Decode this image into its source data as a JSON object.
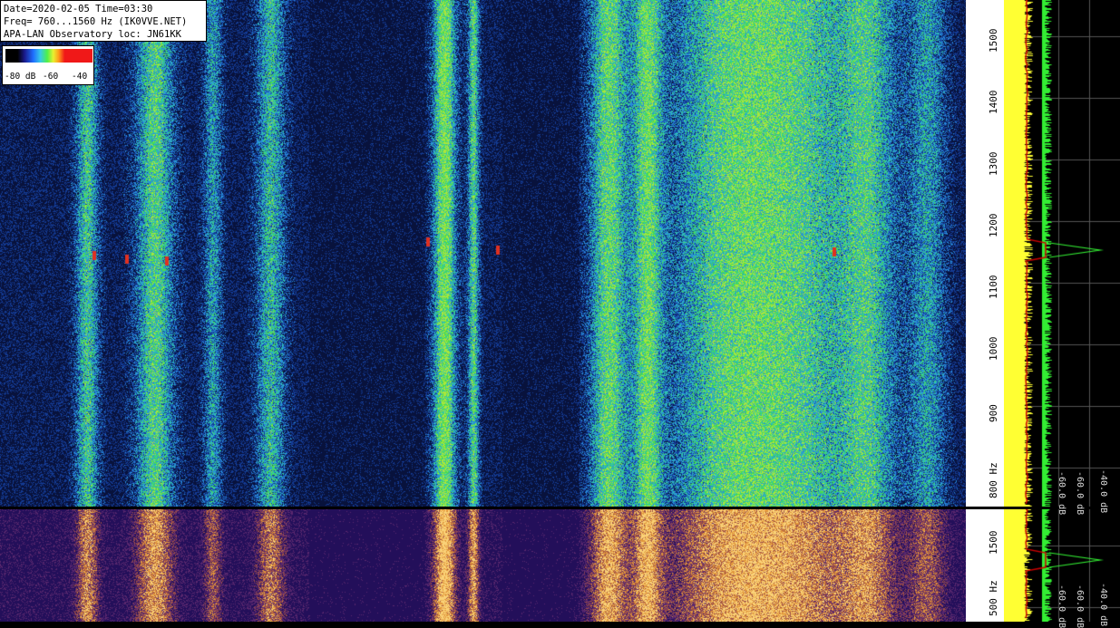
{
  "info": {
    "line1": "Date=2020-02-05 Time=03:30",
    "line2": "Freq= 760...1560 Hz (IK0VVE.NET)",
    "line3": "APA-LAN Observatory loc: JN61KK"
  },
  "scale": {
    "low": "-80 dB",
    "mid": "-60",
    "high": "-40"
  },
  "axis_top": {
    "ticks": [
      "1500",
      "1400",
      "1300",
      "1200",
      "1100",
      "1000",
      "900",
      "800 Hz"
    ]
  },
  "axis_bottom": {
    "ticks": [
      "1500",
      "500 Hz"
    ]
  },
  "spectrum_top_labels": [
    "-60.0 dB",
    "-60.0 dB",
    "-40.0 dB"
  ],
  "spectrum_bottom_labels": [
    "-60.0 dB",
    "-60.0 dB",
    "-40.0 dB"
  ],
  "colors": {
    "waterfall_dark": "#0a1540",
    "waterfall_green": "#3ec85a",
    "heat_dark": "#2a1260",
    "heat_orange": "#f0b040",
    "spectrum_yellow": "#ffff33",
    "spectrum_green": "#33ee33",
    "signal_red": "#cc0000"
  }
}
